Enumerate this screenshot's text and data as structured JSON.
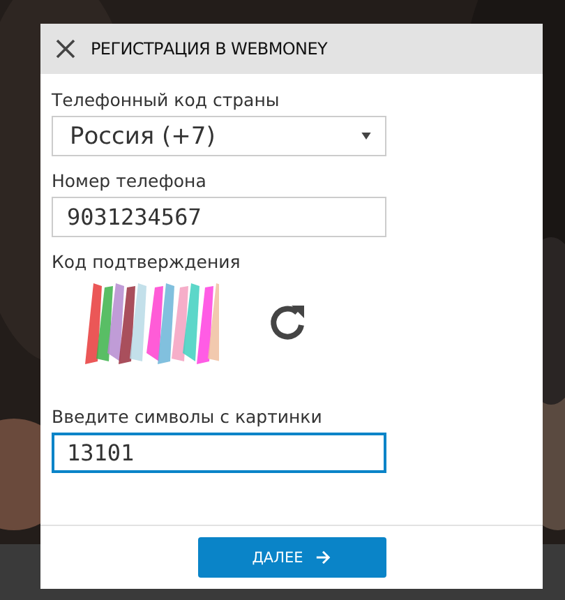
{
  "dialog": {
    "title": "РЕГИСТРАЦИЯ В WEBMONEY",
    "fields": [
      {
        "kind": "select",
        "label": "Телефонный код страны",
        "value": "Россия (+7)",
        "focused": false
      },
      {
        "kind": "input",
        "label": "Номер телефона",
        "value": "9031234567",
        "focused": false
      },
      {
        "kind": "captcha",
        "label": "Код подтверждения"
      },
      {
        "kind": "input",
        "label": "Введите символы с картинки",
        "value": "13101",
        "focused": true
      }
    ],
    "button": "ДАЛЕЕ"
  }
}
